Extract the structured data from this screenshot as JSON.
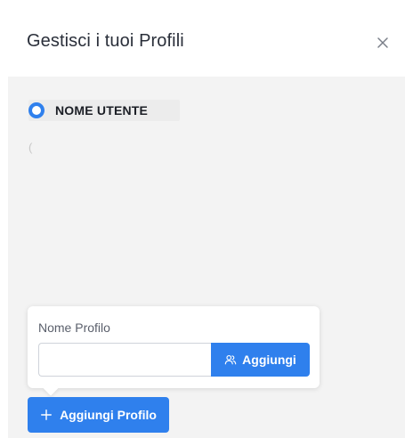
{
  "modal": {
    "title": "Gestisci i tuoi Profili",
    "close_icon": "close-icon"
  },
  "profiles": [
    {
      "label": "NOME UTENTE",
      "selected": true
    }
  ],
  "list_text": "(",
  "popover": {
    "label": "Nome Profilo",
    "input_value": "",
    "input_placeholder": "",
    "button_label": "Aggiungi",
    "button_icon": "users-icon"
  },
  "footer": {
    "add_profile_label": "Aggiungi Profilo",
    "add_profile_icon": "plus-icon"
  },
  "colors": {
    "accent": "#2f80ed",
    "panel_bg": "#f3f3f3"
  }
}
